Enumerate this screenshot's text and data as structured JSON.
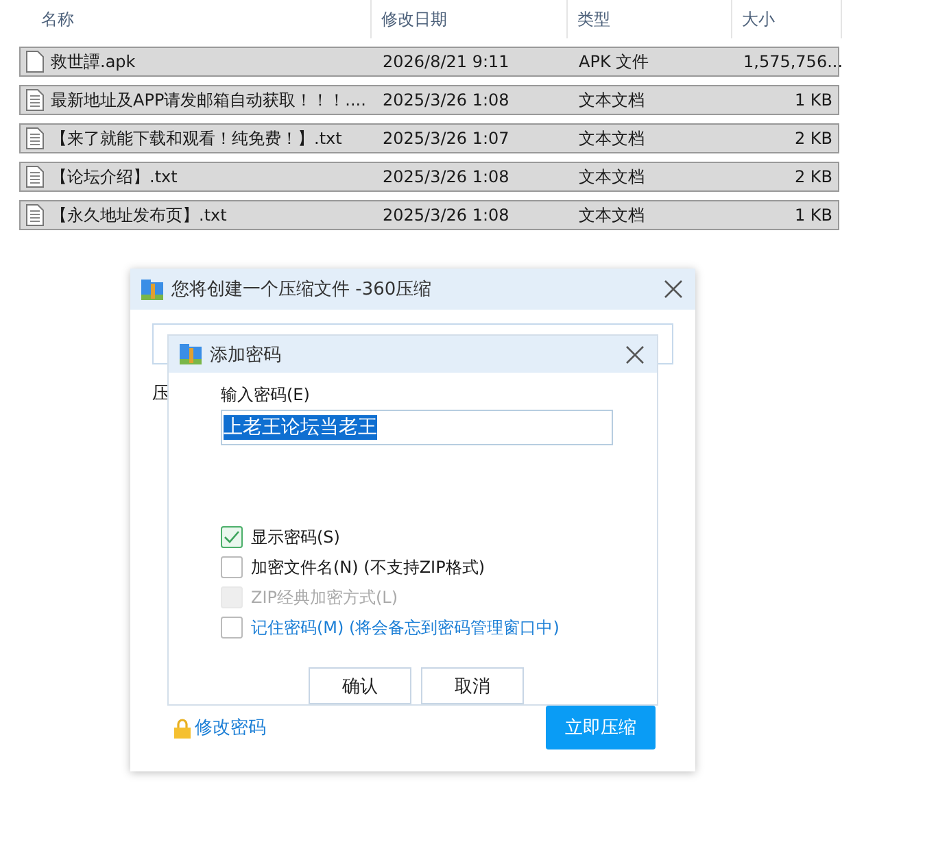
{
  "file_list": {
    "columns": [
      "名称",
      "修改日期",
      "类型",
      "大小"
    ],
    "rows": [
      {
        "kind": "apk",
        "name": "救世譚.apk",
        "date": "2026/8/21 9:11",
        "type": "APK 文件",
        "size": "1,575,756...",
        "selected": true
      },
      {
        "kind": "txt",
        "name": "最新地址及APP请发邮箱自动获取！！！....",
        "date": "2025/3/26 1:08",
        "type": "文本文档",
        "size": "1 KB",
        "selected": true
      },
      {
        "kind": "txt",
        "name": "【来了就能下载和观看！纯免费！】.txt",
        "date": "2025/3/26 1:07",
        "type": "文本文档",
        "size": "2 KB",
        "selected": true
      },
      {
        "kind": "txt",
        "name": "【论坛介绍】.txt",
        "date": "2025/3/26 1:08",
        "type": "文本文档",
        "size": "2 KB",
        "selected": true
      },
      {
        "kind": "txt",
        "name": "【永久地址发布页】.txt",
        "date": "2025/3/26 1:08",
        "type": "文本文档",
        "size": "1 KB",
        "selected": true
      }
    ]
  },
  "compress_dialog": {
    "title": "您将创建一个压缩文件 -360压缩",
    "label_fragment": "压",
    "change_password_link": "修改密码",
    "compress_button": "立即压缩"
  },
  "password_dialog": {
    "title": "添加密码",
    "field_label": "输入密码(E)",
    "password_value": "上老王论坛当老王",
    "options": [
      {
        "label": "显示密码(S)",
        "checked": true,
        "disabled": false,
        "link": false
      },
      {
        "label": "加密文件名(N) (不支持ZIP格式)",
        "checked": false,
        "disabled": false,
        "link": false
      },
      {
        "label": "ZIP经典加密方式(L)",
        "checked": false,
        "disabled": true,
        "link": false
      },
      {
        "label": "记住密码(M) (将会备忘到密码管理窗口中)",
        "checked": false,
        "disabled": false,
        "link": true
      }
    ],
    "buttons": [
      "确认",
      "取消"
    ]
  }
}
